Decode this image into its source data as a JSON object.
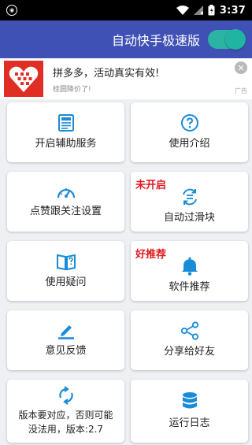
{
  "statusbar": {
    "time": "3:37"
  },
  "appbar": {
    "title": "自动快手极速版",
    "toggle_on": true
  },
  "ad": {
    "title": "拼多多，活动真实有效!",
    "subtitle": "桂圆降价了!",
    "badge": "广告",
    "close_symbol": "×",
    "colors": {
      "logo_bg": "#e02e24"
    }
  },
  "colors": {
    "appbar": "#3f51b5",
    "toggle": "#2bb3a3",
    "icon_blue": "#1a8bd6",
    "tag_red": "#e0191f"
  },
  "cards": [
    {
      "label": "开启辅助服务",
      "icon": "document-icon"
    },
    {
      "label": "使用介绍",
      "icon": "help-icon"
    },
    {
      "label": "点赞跟关注设置",
      "icon": "gauge-icon"
    },
    {
      "label": "自动过滑块",
      "icon": "refresh-list-icon",
      "tag": "未开启"
    },
    {
      "label": "使用疑问",
      "icon": "book-icon"
    },
    {
      "label": "软件推荐",
      "icon": "bell-icon",
      "tag": "好推荐"
    },
    {
      "label": "意见反馈",
      "icon": "edit-icon"
    },
    {
      "label": "分享给好友",
      "icon": "share-icon"
    },
    {
      "label": "版本要对应，否则可能没法用，版本:2.7",
      "icon": "sync-icon"
    },
    {
      "label": "运行日志",
      "icon": "database-icon"
    }
  ]
}
